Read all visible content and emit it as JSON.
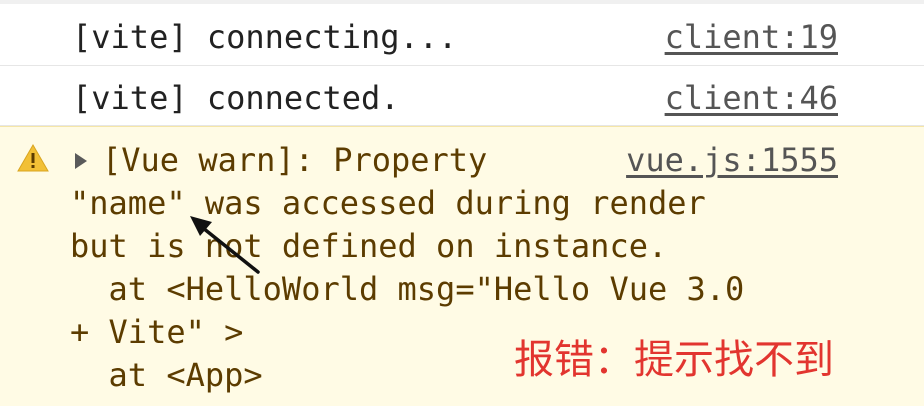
{
  "console": {
    "logs": [
      {
        "text": "[vite] connecting...",
        "source": "client:19"
      },
      {
        "text": "[vite] connected.",
        "source": "client:46"
      }
    ],
    "warning": {
      "icon": "warning-icon",
      "source": "vue.js:1555",
      "lines": [
        "[Vue warn]: Property",
        "\"name\" was accessed during render",
        "but is not defined on instance.",
        "  at <HelloWorld msg=\"Hello Vue 3.0",
        "+ Vite\" >",
        "  at <App>"
      ]
    }
  },
  "annotation": {
    "text": "报错：提示找不到",
    "color": "#e2352f"
  },
  "colors": {
    "warning_background": "#fffbe5",
    "warning_text": "#5c3c00",
    "log_text": "#222222"
  }
}
